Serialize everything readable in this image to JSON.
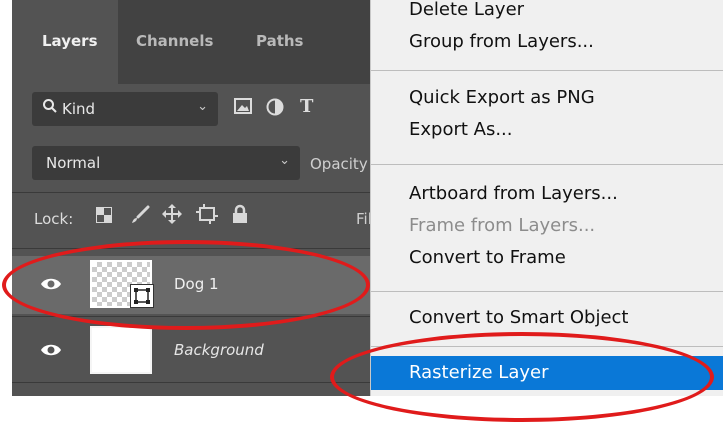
{
  "panel": {
    "tabs": [
      "Layers",
      "Channels",
      "Paths"
    ],
    "filter": {
      "kind_label": "Kind",
      "icons": [
        "search-icon",
        "image-filter-icon",
        "adjustment-filter-icon",
        "type-filter-icon"
      ]
    },
    "blend_mode": "Normal",
    "opacity_label": "Opacity",
    "lock_label": "Lock:",
    "lock_icons": [
      "lock-transparent-icon",
      "lock-paint-icon",
      "lock-move-icon",
      "lock-artboard-icon",
      "lock-all-icon"
    ],
    "fill_label": "Fil",
    "layers": [
      {
        "name": "Dog 1",
        "selected": true,
        "thumb": "smart-object-checker"
      },
      {
        "name": "Background",
        "selected": false,
        "thumb": "white"
      }
    ]
  },
  "menu": {
    "items": [
      {
        "label": "Delete Layer",
        "disabled": false
      },
      {
        "label": "Group from Layers...",
        "disabled": false
      },
      {
        "label": "Quick Export as PNG",
        "disabled": false
      },
      {
        "label": "Export As...",
        "disabled": false
      },
      {
        "label": "Artboard from Layers...",
        "disabled": false
      },
      {
        "label": "Frame from Layers...",
        "disabled": true
      },
      {
        "label": "Convert to Frame",
        "disabled": false
      },
      {
        "label": "Convert to Smart Object",
        "disabled": false
      },
      {
        "label": "Rasterize Layer",
        "disabled": false,
        "highlighted": true
      }
    ]
  },
  "colors": {
    "panel_bg": "#535353",
    "menu_highlight": "#0a78d7",
    "annotation": "#e01b1b"
  }
}
